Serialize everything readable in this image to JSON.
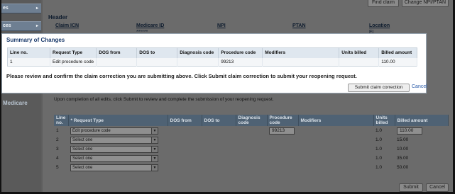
{
  "sidebar": {
    "tabs": [
      {
        "label": "es",
        "arrow": "▸"
      },
      {
        "label": "ces",
        "arrow": "▸"
      },
      {
        "label": "",
        "arrow": "▸"
      }
    ],
    "medicare_label": "Medicare"
  },
  "top_buttons": {
    "find_claim": "Find claim",
    "change_npi": "Change NPI/PTAN"
  },
  "header": {
    "title": "Header",
    "columns": [
      {
        "label": "Claim ICN",
        "value": ""
      },
      {
        "label": "Medicare ID",
        "value": "******"
      },
      {
        "label": "NPI",
        "value": ""
      },
      {
        "label": "PTAN",
        "value": ""
      },
      {
        "label": "Location",
        "value": "FI"
      }
    ]
  },
  "modal": {
    "title": "Summary of Changes",
    "columns": [
      "Line no.",
      "Request Type",
      "DOS from",
      "DOS to",
      "Diagnosis code",
      "Procedure code",
      "Modifiers",
      "Units billed",
      "Billed amount"
    ],
    "rows": [
      {
        "line_no": "1",
        "request_type": "Edit procedure code",
        "dos_from": "",
        "dos_to": "",
        "diagnosis_code": "",
        "procedure_code": "99213",
        "modifiers": "",
        "units_billed": "",
        "billed_amount": "110.00"
      }
    ],
    "confirm_text": "Please review and confirm the claim correction you are submitting above. Click Submit claim correction to submit your reopening request.",
    "submit_label": "Submit claim correction",
    "cancel_label": "Cancel"
  },
  "completion_text": "Upon completion of all edits, click Submit to review and complete the submission of your reopening request.",
  "edit_table": {
    "headers": {
      "line_no": "Line no.",
      "request_type": "* Request Type",
      "dos_from": "DOS from",
      "dos_to": "DOS to",
      "diagnosis_code": "Diagnosis code",
      "procedure_code": "Procedure code",
      "modifiers": "Modifiers",
      "units_billed": "Units billed",
      "billed_amount": "Billed amount"
    },
    "rows": [
      {
        "line_no": "1",
        "request_type": "Edit procedure code",
        "procedure_code": "99213",
        "units": "1.0",
        "amount": "110.00"
      },
      {
        "line_no": "2",
        "request_type": "Select one",
        "procedure_code": "",
        "units": "1.0",
        "amount": "15.00"
      },
      {
        "line_no": "3",
        "request_type": "Select one",
        "procedure_code": "",
        "units": "1.0",
        "amount": "10.00"
      },
      {
        "line_no": "4",
        "request_type": "Select one",
        "procedure_code": "",
        "units": "1.0",
        "amount": "35.00"
      },
      {
        "line_no": "5",
        "request_type": "Select one",
        "procedure_code": "",
        "units": "1.0",
        "amount": "50.00"
      }
    ]
  },
  "footer": {
    "submit_label": "Submit",
    "cancel_label": "Cancel"
  },
  "colors": {
    "modal_title": "#1a3a6b",
    "link": "#2557a7",
    "overlay": "#5e5e5e"
  }
}
